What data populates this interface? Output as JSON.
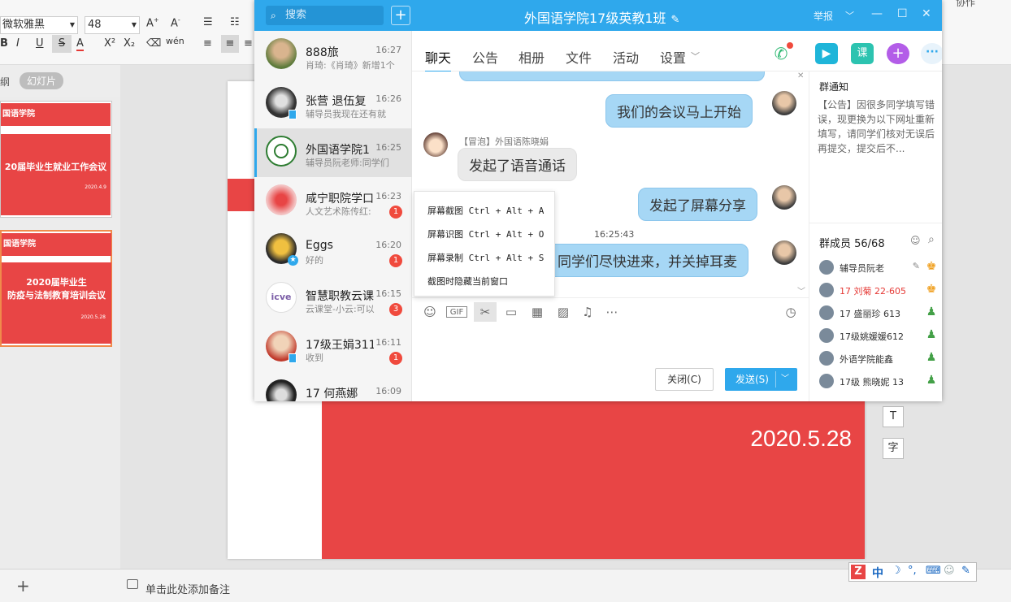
{
  "ppt": {
    "font_name": "微软雅黑",
    "font_size": "48",
    "tab_outline": "纲",
    "tab_slides": "幻灯片",
    "thumb1_header": "国语学院",
    "thumb1_title": "20届毕业生就业工作会议",
    "thumb1_date": "2020.4.9",
    "thumb2_header": "国语学院",
    "thumb2_title_1": "2020届毕业生",
    "thumb2_title_2": "防疫与法制教育培训会议",
    "thumb2_date": "2020.5.28",
    "slide_date": "2020.5.28",
    "notes_placeholder": "单击此处添加备注",
    "add_slide": "+",
    "top_right_text": "协作",
    "side_btn_1": "T",
    "side_btn_2": "字"
  },
  "ime": {
    "lang": "中",
    "items": [
      "☽",
      "°,",
      "⌨",
      "☺",
      "✎"
    ]
  },
  "qq": {
    "search_placeholder": "搜索",
    "title": "外国语学院17级英教1班",
    "report": "举报",
    "conversations": [
      {
        "name": "888旅",
        "time": "16:27",
        "preview": "肖琦:《肖琦》新增1个",
        "badge": ""
      },
      {
        "name": "张营 退伍复",
        "time": "16:26",
        "preview": "辅导员我现在还有就",
        "badge": ""
      },
      {
        "name": "外国语学院1",
        "time": "16:25",
        "preview": "辅导员阮老师:同学们",
        "badge": ""
      },
      {
        "name": "咸宁职院学口",
        "time": "16:23",
        "preview": "人文艺术陈传红:",
        "badge": "1"
      },
      {
        "name": "Eggs",
        "time": "16:20",
        "preview": "好的",
        "badge": "1"
      },
      {
        "name": "智慧职教云课",
        "time": "16:15",
        "preview": "云课堂-小云:可以",
        "badge": "3"
      },
      {
        "name": "17级王娟311",
        "time": "16:11",
        "preview": "收到",
        "badge": "1"
      },
      {
        "name": "17 何燕娜",
        "time": "16:09",
        "preview": "",
        "badge": ""
      }
    ],
    "tabs": [
      "聊天",
      "公告",
      "相册",
      "文件",
      "活动",
      "设置"
    ],
    "messages": {
      "m1": "我们的会议马上开始",
      "sender": "【冒泡】外国语陈晓娟",
      "m2": "发起了语音通话",
      "m3": "发起了屏幕分享",
      "time": "16:25:43",
      "m4": "同学们尽快进来，并关掉耳麦"
    },
    "context_menu": [
      "屏幕截图 Ctrl + Alt + A",
      "屏幕识图 Ctrl + Alt + O",
      "屏幕录制 Ctrl + Alt + S",
      "截图时隐藏当前窗口"
    ],
    "close_button": "关闭(C)",
    "send_button": "发送(S)",
    "notice_title": "群通知",
    "notice_text": "【公告】因很多同学填写错误，现更换为以下网址重新填写，请同学们核对无误后再提交，提交后不...",
    "members_title": "群成员 56/68",
    "members": [
      {
        "name": "辅导员阮老",
        "extra": "",
        "color": "#333"
      },
      {
        "name": "17 刘菊 22-605",
        "extra": "",
        "color": "#e53935"
      },
      {
        "name": "17  盛丽珍 613",
        "extra": "",
        "color": "#333"
      },
      {
        "name": "17级姚媛媛612",
        "extra": "",
        "color": "#333"
      },
      {
        "name": "外语学院能鑫",
        "extra": "",
        "color": "#333"
      },
      {
        "name": "17级 熊晓妮 13",
        "extra": "",
        "color": "#333"
      }
    ],
    "colors": {
      "header": "#2fa8ec",
      "bubble": "#a6d7f5",
      "badge": "#f04a3d"
    }
  }
}
